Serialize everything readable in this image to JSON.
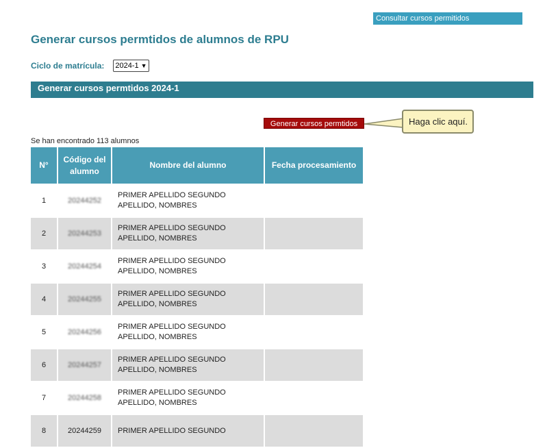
{
  "header": {
    "top_link": "Consultar cursos permitidos",
    "title": "Generar cursos permtidos de alumnos de RPU"
  },
  "filter": {
    "cycle_label": "Ciclo de matrícula:",
    "cycle_value": "2024-1"
  },
  "section": {
    "title": "Generar cursos permtidos 2024-1"
  },
  "actions": {
    "generate_label": "Generar cursos permtidos",
    "tooltip_text": "Haga clic aquí."
  },
  "results": {
    "count_text": "Se han encontrado 113 alumnos",
    "columns": [
      "N°",
      "Código del alumno",
      "Nombre del alumno",
      "Fecha procesamiento"
    ],
    "rows": [
      {
        "num": "1",
        "code": "20244252",
        "name": "PRIMER APELLIDO SEGUNDO APELLIDO, NOMBRES",
        "date": ""
      },
      {
        "num": "2",
        "code": "20244253",
        "name": "PRIMER APELLIDO SEGUNDO APELLIDO, NOMBRES",
        "date": ""
      },
      {
        "num": "3",
        "code": "20244254",
        "name": "PRIMER APELLIDO SEGUNDO APELLIDO, NOMBRES",
        "date": ""
      },
      {
        "num": "4",
        "code": "20244255",
        "name": "PRIMER APELLIDO SEGUNDO APELLIDO, NOMBRES",
        "date": ""
      },
      {
        "num": "5",
        "code": "20244256",
        "name": "PRIMER APELLIDO SEGUNDO APELLIDO, NOMBRES",
        "date": ""
      },
      {
        "num": "6",
        "code": "20244257",
        "name": "PRIMER APELLIDO SEGUNDO APELLIDO, NOMBRES",
        "date": ""
      },
      {
        "num": "7",
        "code": "20244258",
        "name": "PRIMER APELLIDO SEGUNDO APELLIDO, NOMBRES",
        "date": ""
      },
      {
        "num": "8",
        "code": "20244259",
        "name": "PRIMER APELLIDO SEGUNDO",
        "date": ""
      }
    ]
  }
}
